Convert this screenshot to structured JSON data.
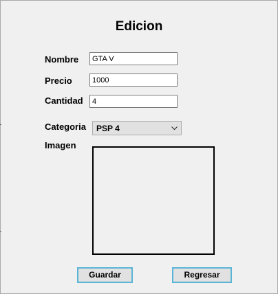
{
  "form": {
    "title": "Edicion",
    "fields": {
      "nombre_label": "Nombre",
      "nombre_value": "GTA V",
      "precio_label": "Precio",
      "precio_value": "1000",
      "cantidad_label": "Cantidad",
      "cantidad_value": "4",
      "categoria_label": "Categoria",
      "categoria_value": "PSP 4",
      "imagen_label": "Imagen"
    },
    "buttons": {
      "guardar": "Guardar",
      "regresar": "Regresar"
    }
  },
  "colors": {
    "background": "#f0f0f0",
    "button_border": "#5ab4d6"
  },
  "icons": {
    "combo_arrow": "chevron-down-icon"
  }
}
